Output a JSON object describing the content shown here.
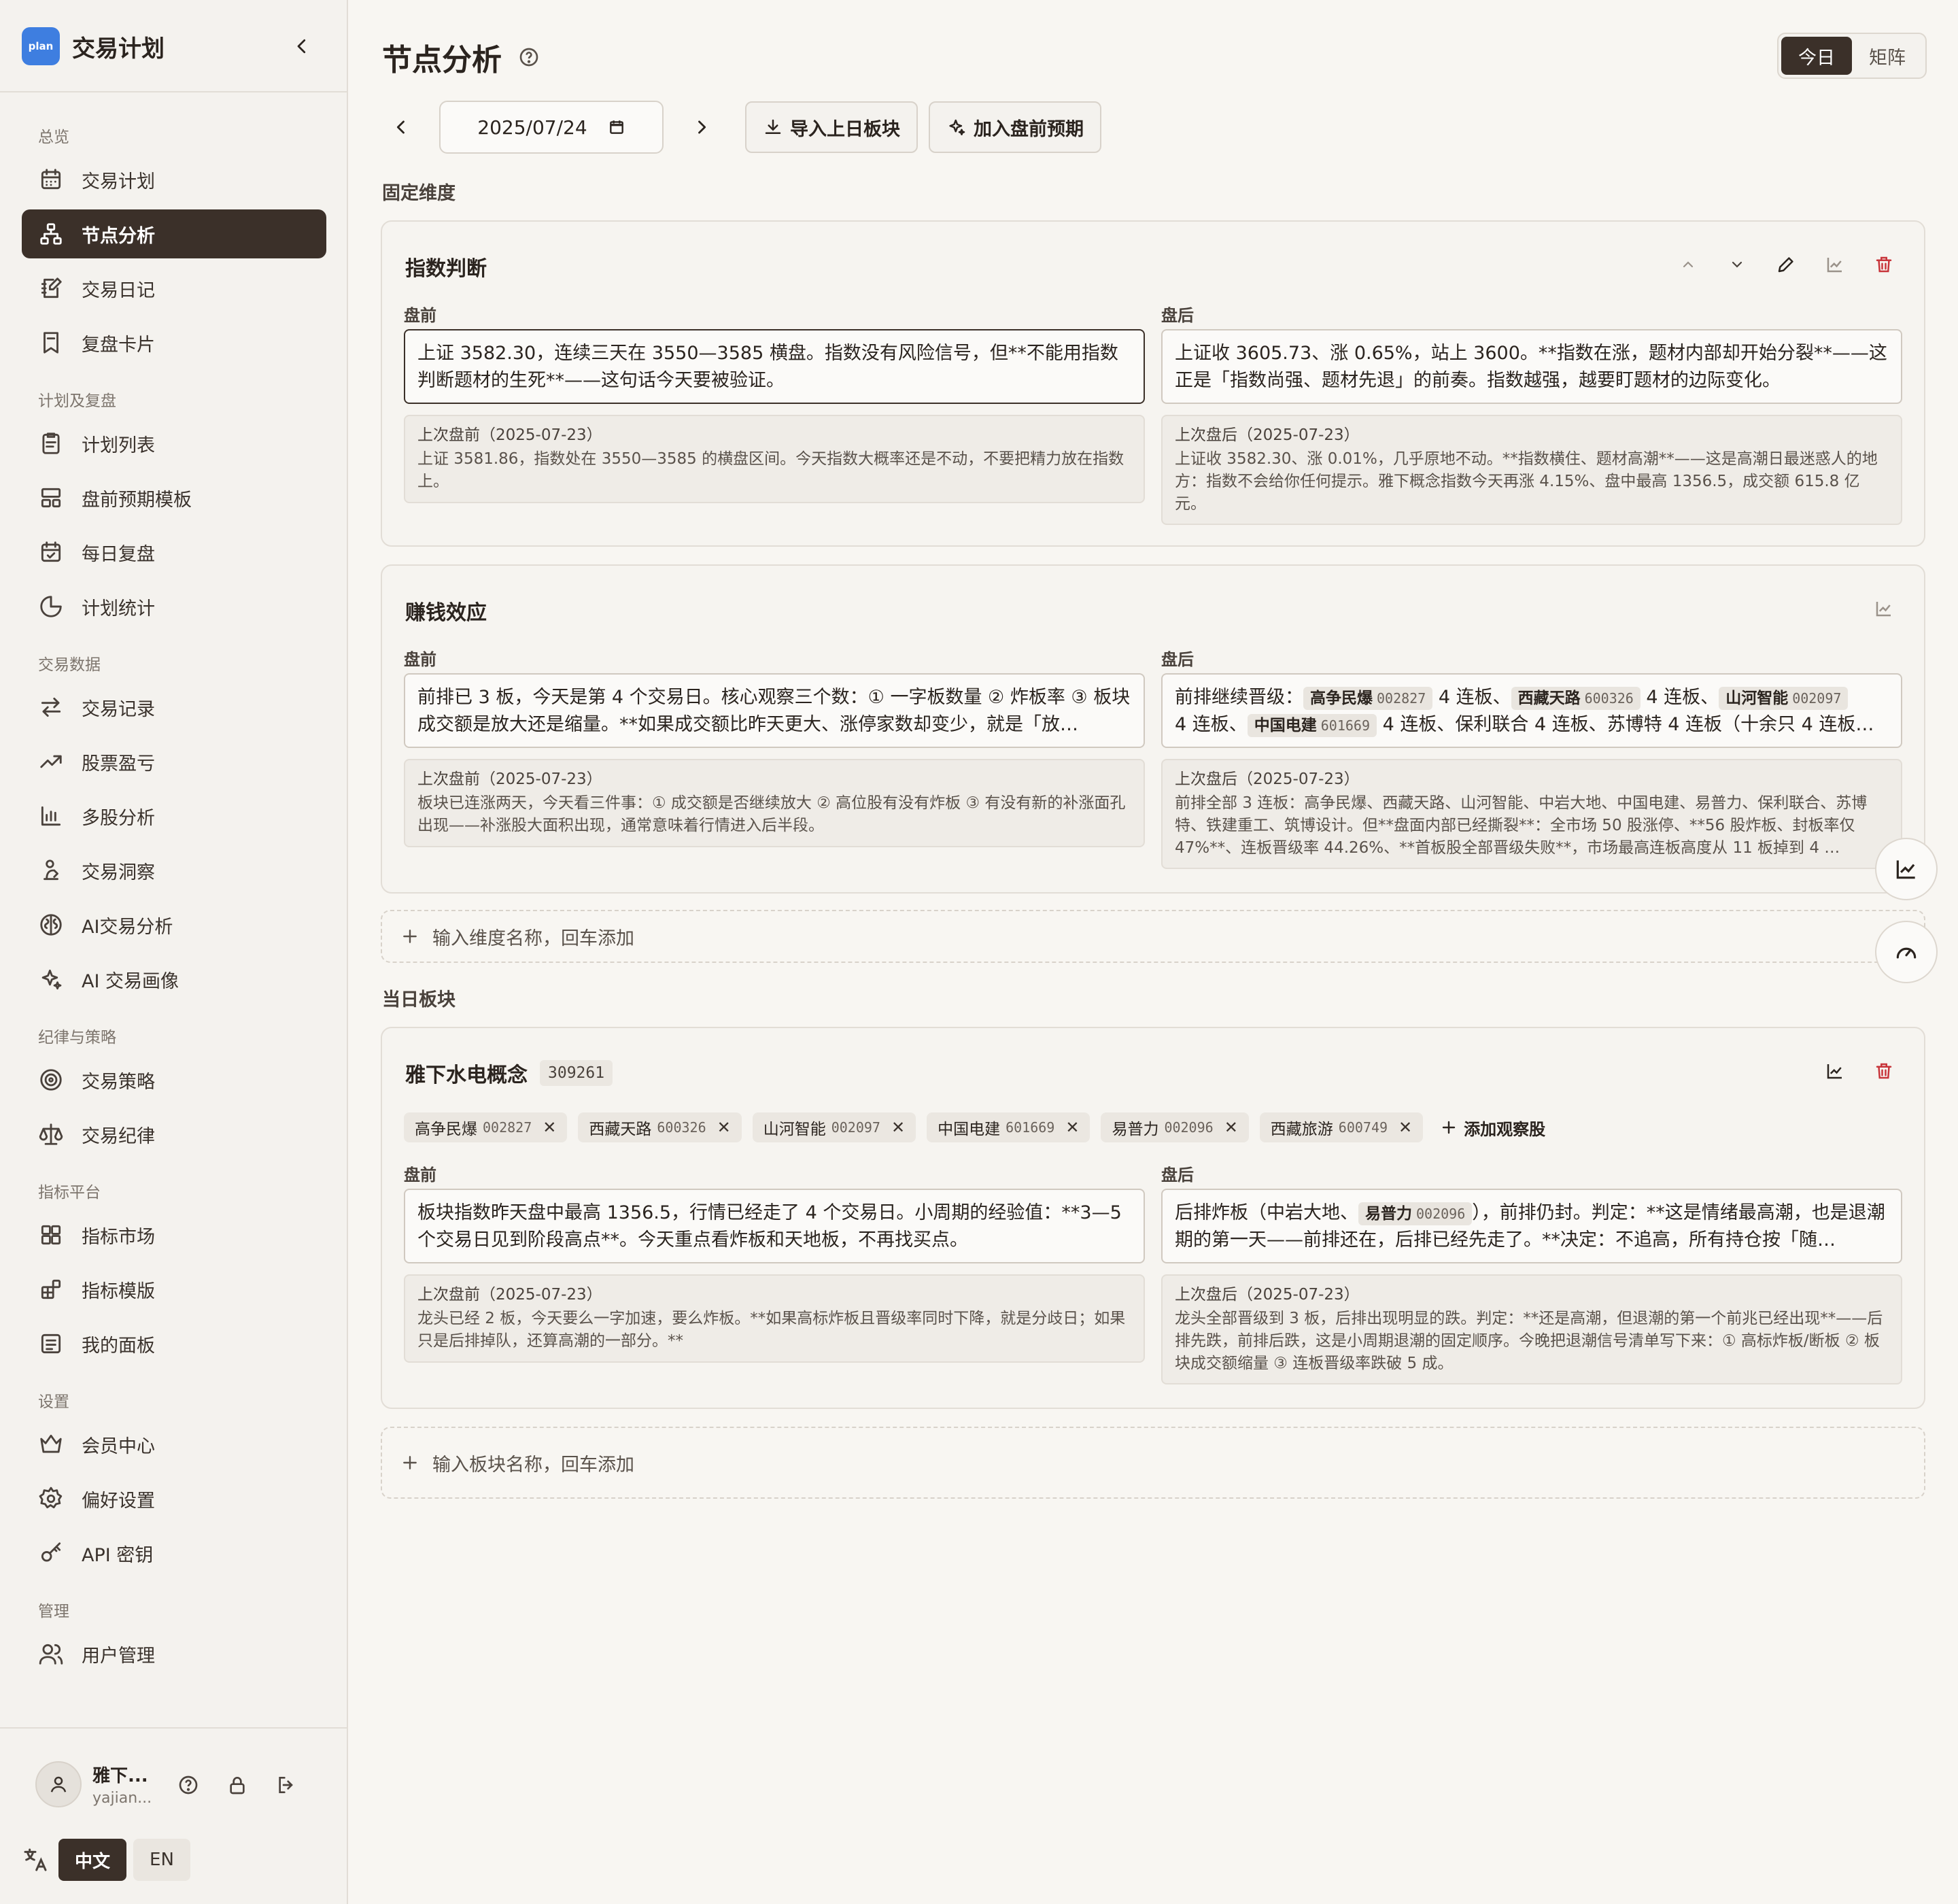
{
  "app": {
    "logo_text": "plan",
    "title": "交易计划"
  },
  "sidebar": {
    "groups": [
      {
        "label": "总览",
        "items": [
          {
            "label": "交易计划",
            "icon": "calendar-icon"
          },
          {
            "label": "节点分析",
            "icon": "nodes-icon",
            "active": true
          },
          {
            "label": "交易日记",
            "icon": "journal-icon"
          },
          {
            "label": "复盘卡片",
            "icon": "card-icon"
          }
        ]
      },
      {
        "label": "计划及复盘",
        "items": [
          {
            "label": "计划列表",
            "icon": "clipboard-icon"
          },
          {
            "label": "盘前预期模板",
            "icon": "template-icon"
          },
          {
            "label": "每日复盘",
            "icon": "calendar-check-icon"
          },
          {
            "label": "计划统计",
            "icon": "pie-icon"
          }
        ]
      },
      {
        "label": "交易数据",
        "items": [
          {
            "label": "交易记录",
            "icon": "swap-icon"
          },
          {
            "label": "股票盈亏",
            "icon": "trend-up-icon"
          },
          {
            "label": "多股分析",
            "icon": "bar-chart-icon"
          },
          {
            "label": "交易洞察",
            "icon": "insight-icon"
          },
          {
            "label": "AI交易分析",
            "icon": "brain-icon"
          },
          {
            "label": "AI 交易画像",
            "icon": "sparkles-icon"
          }
        ]
      },
      {
        "label": "纪律与策略",
        "items": [
          {
            "label": "交易策略",
            "icon": "target-icon"
          },
          {
            "label": "交易纪律",
            "icon": "scale-icon"
          }
        ]
      },
      {
        "label": "指标平台",
        "items": [
          {
            "label": "指标市场",
            "icon": "grid-icon"
          },
          {
            "label": "指标模版",
            "icon": "blocks-icon"
          },
          {
            "label": "我的面板",
            "icon": "panel-icon"
          }
        ]
      },
      {
        "label": "设置",
        "items": [
          {
            "label": "会员中心",
            "icon": "crown-icon"
          },
          {
            "label": "偏好设置",
            "icon": "gear-icon"
          },
          {
            "label": "API 密钥",
            "icon": "key-icon"
          }
        ]
      },
      {
        "label": "管理",
        "items": [
          {
            "label": "用户管理",
            "icon": "users-icon"
          }
        ]
      }
    ],
    "user": {
      "name": "雅下...",
      "email": "yajian..."
    },
    "lang": {
      "zh": "中文",
      "en": "EN"
    }
  },
  "page": {
    "title": "节点分析",
    "view_toggle": {
      "today": "今日",
      "matrix": "矩阵"
    },
    "date": "2025/07/24",
    "btn_import": "导入上日板块",
    "btn_add_premarket": "加入盘前预期",
    "fixed_label": "固定维度",
    "today_sectors_label": "当日板块",
    "add_dimension_placeholder": "输入维度名称，回车添加",
    "add_sector_placeholder": "输入板块名称，回车添加"
  },
  "cards": {
    "index": {
      "title": "指数判断",
      "pre_label": "盘前",
      "post_label": "盘后",
      "pre": "上证 3582.30，连续三天在 3550—3585 横盘。指数没有风险信号，但**不能用指数判断题材的生死**——这句话今天要被验证。",
      "post": "上证收 3605.73、涨 0.65%，站上 3600。**指数在涨，题材内部却开始分裂**——这正是「指数尚强、题材先退」的前奏。指数越强，越要盯题材的边际变化。",
      "prev_pre_head": "上次盘前（2025-07-23）",
      "prev_pre": "上证 3581.86，指数处在 3550—3585 的横盘区间。今天指数大概率还是不动，不要把精力放在指数上。",
      "prev_post_head": "上次盘后（2025-07-23）",
      "prev_post": "上证收 3582.30、涨 0.01%，几乎原地不动。**指数横住、题材高潮**——这是高潮日最迷惑人的地方：指数不会给你任何提示。雅下概念指数今天再涨 4.15%、盘中最高 1356.5，成交额 615.8 亿元。"
    },
    "money": {
      "title": "赚钱效应",
      "pre_label": "盘前",
      "post_label": "盘后",
      "pre": "前排已 3 板，今天是第 4 个交易日。核心观察三个数：① 一字板数量 ② 炸板率 ③ 板块成交额是放大还是缩量。**如果成交额比昨天更大、涨停家数却变少，就是「放…",
      "post_a": "前排继续晋级：",
      "post_stocks": [
        {
          "name": "高争民爆",
          "code": "002827",
          "suffix": " 4 连板、"
        },
        {
          "name": "西藏天路",
          "code": "600326",
          "suffix": " 4 连板、"
        },
        {
          "name": "山河智能",
          "code": "002097",
          "suffix": ""
        }
      ],
      "post_b1": "4 连板、",
      "post_b_stock": {
        "name": "中国电建",
        "code": "601669"
      },
      "post_b2": " 4 连板、保利联合 4 连板、苏博特 4 连板（十余只 4 连板…",
      "prev_pre_head": "上次盘前（2025-07-23）",
      "prev_pre": "板块已连涨两天，今天看三件事：① 成交额是否继续放大 ② 高位股有没有炸板 ③ 有没有新的补涨面孔出现——补涨股大面积出现，通常意味着行情进入后半段。",
      "prev_post_head": "上次盘后（2025-07-23）",
      "prev_post": "前排全部 3 连板：高争民爆、西藏天路、山河智能、中岩大地、中国电建、易普力、保利联合、苏博特、铁建重工、筑博设计。但**盘面内部已经撕裂**：全市场 50 股涨停、**56 股炸板、封板率仅 47%**、连板晋级率 44.26%、**首板股全部晋级失败**，市场最高连板高度从 11 板掉到 4 …"
    },
    "sector": {
      "title": "雅下水电概念",
      "code": "309261",
      "stocks": [
        {
          "name": "高争民爆",
          "code": "002827"
        },
        {
          "name": "西藏天路",
          "code": "600326"
        },
        {
          "name": "山河智能",
          "code": "002097"
        },
        {
          "name": "中国电建",
          "code": "601669"
        },
        {
          "name": "易普力",
          "code": "002096"
        },
        {
          "name": "西藏旅游",
          "code": "600749"
        }
      ],
      "remove_mark": "✕",
      "add_stock": "添加观察股",
      "pre_label": "盘前",
      "post_label": "盘后",
      "pre": "板块指数昨天盘中最高 1356.5，行情已经走了 4 个交易日。小周期的经验值：**3—5 个交易日见到阶段高点**。今天重点看炸板和天地板，不再找买点。",
      "post_a": "后排炸板（中岩大地、",
      "post_stock": {
        "name": "易普力",
        "code": "002096"
      },
      "post_b": "），前排仍封。判定：**这是情绪最高潮，也是退潮期的第一天——前排还在，后排已经先走了。**决定：不追高，所有持仓按「随…",
      "prev_pre_head": "上次盘前（2025-07-23）",
      "prev_pre": "龙头已经 2 板，今天要么一字加速，要么炸板。**如果高标炸板且晋级率同时下降，就是分歧日；如果只是后排掉队，还算高潮的一部分。**",
      "prev_post_head": "上次盘后（2025-07-23）",
      "prev_post": "龙头全部晋级到 3 板，后排出现明显的跌。判定：**还是高潮，但退潮的第一个前兆已经出现**——后排先跌，前排后跌，这是小周期退潮的固定顺序。今晚把退潮信号清单写下来：① 高标炸板/断板 ② 板块成交额缩量 ③ 连板晋级率跌破 5 成。"
    }
  },
  "colors": {
    "accent": "#3b3029",
    "danger": "#c8343a",
    "logo": "#3e7ee0"
  }
}
